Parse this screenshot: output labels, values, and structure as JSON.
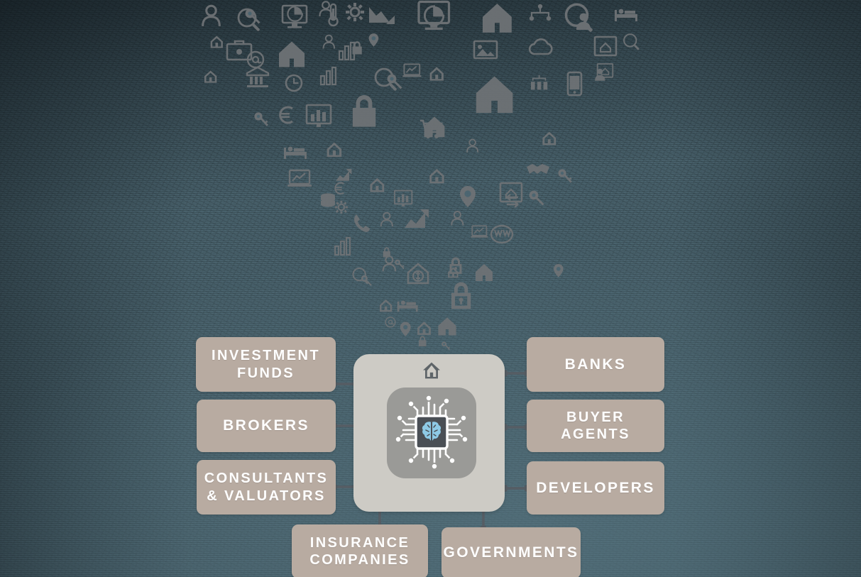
{
  "diagram": {
    "type": "hub-and-spoke",
    "title_visible": false,
    "hub": {
      "name": "ai-hub",
      "icons": [
        "house-icon",
        "ai-chip-icon",
        "brain-icon"
      ],
      "brain_color": "#8ecae6",
      "chip_color": "#4a4f55",
      "panel_color": "#cdcbc5",
      "inner_panel_color": "#9a9a97"
    },
    "nodes": [
      {
        "id": "investment-funds",
        "label": "INVESTMENT\nFUNDS",
        "lines": [
          "INVESTMENT",
          "FUNDS"
        ],
        "side": "left"
      },
      {
        "id": "brokers",
        "label": "BROKERS",
        "lines": [
          "BROKERS"
        ],
        "side": "left"
      },
      {
        "id": "consultants-valuators",
        "label": "CONSULTANTS\n& VALUATORS",
        "lines": [
          "CONSULTANTS",
          "& VALUATORS"
        ],
        "side": "left"
      },
      {
        "id": "banks",
        "label": "BANKS",
        "lines": [
          "BANKS"
        ],
        "side": "right"
      },
      {
        "id": "buyer-agents",
        "label": "BUYER\nAGENTS",
        "lines": [
          "BUYER",
          "AGENTS"
        ],
        "side": "right"
      },
      {
        "id": "developers",
        "label": "DEVELOPERS",
        "lines": [
          "DEVELOPERS"
        ],
        "side": "right"
      },
      {
        "id": "insurance-companies",
        "label": "INSURANCE\nCOMPANIES",
        "lines": [
          "INSURANCE",
          "COMPANIES"
        ],
        "side": "bottom"
      },
      {
        "id": "governments",
        "label": "GOVERNMENTS",
        "lines": [
          "GOVERNMENTS"
        ],
        "side": "bottom"
      }
    ]
  },
  "colors": {
    "background_teal": "#4d6772",
    "node_taupe": "#b8aba1",
    "node_text": "#ffffff",
    "connector": "#565d64",
    "icon_cloud": "#6e7275",
    "accent_blue": "#8ecae6"
  },
  "icon_cloud": {
    "name": "real-estate-icon-cloud",
    "shape": "inverted-triangle-funnel",
    "icons": [
      "person-icon",
      "key-search-icon",
      "pie-chart-monitor-icon",
      "thermometer-icon",
      "chart-down-icon",
      "pie-chart-screen-icon",
      "house-icon",
      "people-network-icon",
      "person-search-icon",
      "bed-icon",
      "house-small-icon",
      "briefcase-icon",
      "at-sign-icon",
      "bank-icon",
      "clock-icon",
      "bar-chart-icon",
      "image-frame-icon",
      "cloud-icon",
      "lock-icon",
      "euro-icon",
      "key-icon",
      "presentation-chart-icon",
      "shopping-cart-house-icon",
      "location-pin-icon",
      "handshake-icon",
      "smartphone-icon",
      "org-chart-icon",
      "house-key-icon",
      "coins-icon",
      "phone-icon",
      "growth-arrow-icon",
      "www-globe-icon",
      "laptop-chart-icon",
      "house-gear-dollar-icon",
      "unlock-icon",
      "padlock-icon",
      "house-exchange-icon",
      "house-search-icon",
      "magnifier-network-icon",
      "bed-small-icon",
      "gear-icon"
    ]
  }
}
